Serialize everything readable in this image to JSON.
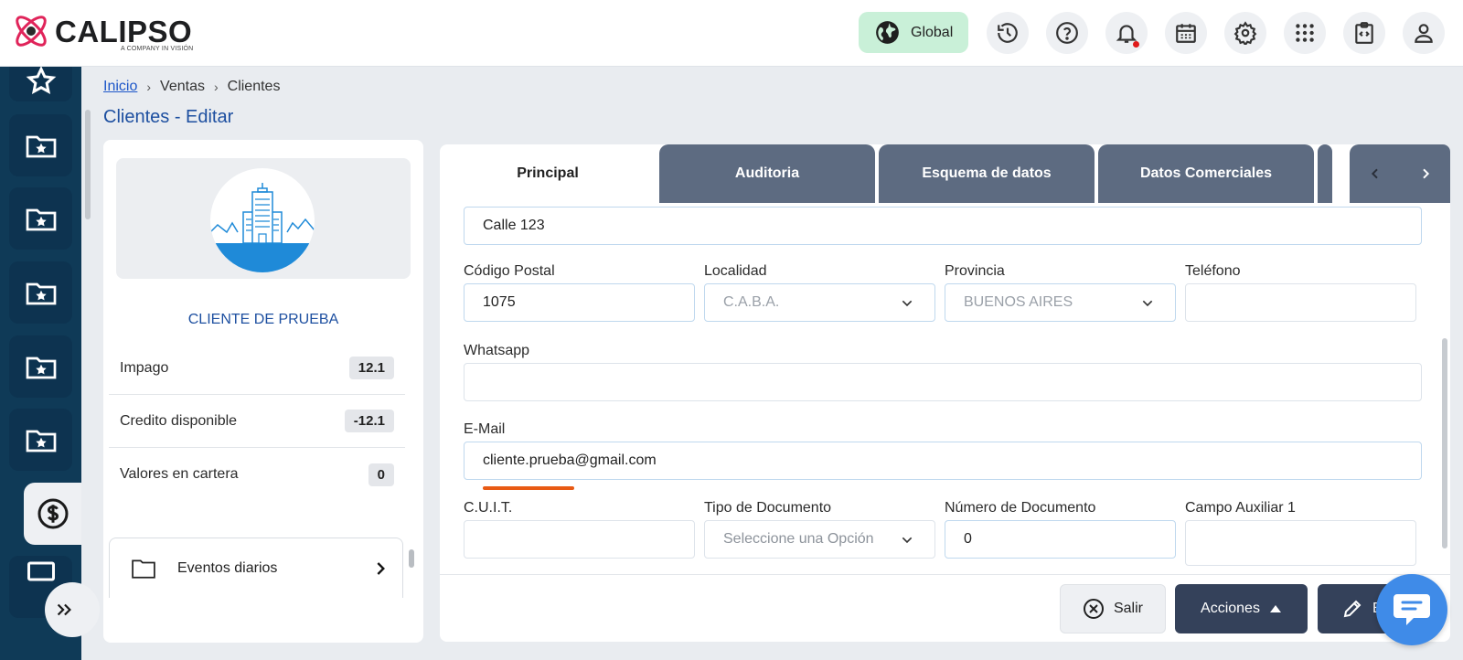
{
  "brand": {
    "name": "CALIPSO",
    "tagline": "A COMPANY IN VISIÓN"
  },
  "header": {
    "global_label": "Global",
    "icons": [
      "history-icon",
      "help-icon",
      "bell-icon",
      "calendar-icon",
      "settings-icon",
      "apps-grid-icon",
      "code-clipboard-icon",
      "user-icon"
    ]
  },
  "breadcrumb": {
    "home": "Inicio",
    "level2": "Ventas",
    "level3": "Clientes"
  },
  "page_title": "Clientes - Editar",
  "client": {
    "name": "CLIENTE DE PRUEBA",
    "stats": [
      {
        "label": "Impago",
        "value": "12.1"
      },
      {
        "label": "Credito disponible",
        "value": "-12.1"
      },
      {
        "label": "Valores en cartera",
        "value": "0"
      }
    ],
    "events_label": "Eventos diarios"
  },
  "tabs": [
    "Principal",
    "Auditoria",
    "Esquema de datos",
    "Datos Comerciales"
  ],
  "form": {
    "address_value": "Calle 123",
    "codigo_postal": {
      "label": "Código Postal",
      "value": "1075"
    },
    "localidad": {
      "label": "Localidad",
      "value": "C.A.B.A."
    },
    "provincia": {
      "label": "Provincia",
      "value": "BUENOS AIRES"
    },
    "telefono": {
      "label": "Teléfono",
      "value": ""
    },
    "whatsapp": {
      "label": "Whatsapp",
      "value": ""
    },
    "email": {
      "label": "E-Mail",
      "value": "cliente.prueba@gmail.com"
    },
    "cuit": {
      "label": "C.U.I.T.",
      "value": ""
    },
    "tipo_documento": {
      "label": "Tipo de Documento",
      "placeholder": "Seleccione una Opción"
    },
    "numero_documento": {
      "label": "Número de Documento",
      "value": "0"
    },
    "campo_auxiliar": {
      "label": "Campo Auxiliar 1",
      "value": ""
    }
  },
  "footer": {
    "salir": "Salir",
    "acciones": "Acciones",
    "editar": "E"
  },
  "colors": {
    "sidebar": "#0f3a57",
    "tab_inactive": "#5d6b81",
    "primary_button": "#34415a",
    "title_blue": "#1d4fa0",
    "global_green": "#c9f0d8",
    "chat_blue": "#3f8be8",
    "mark_orange": "#e85a14"
  }
}
